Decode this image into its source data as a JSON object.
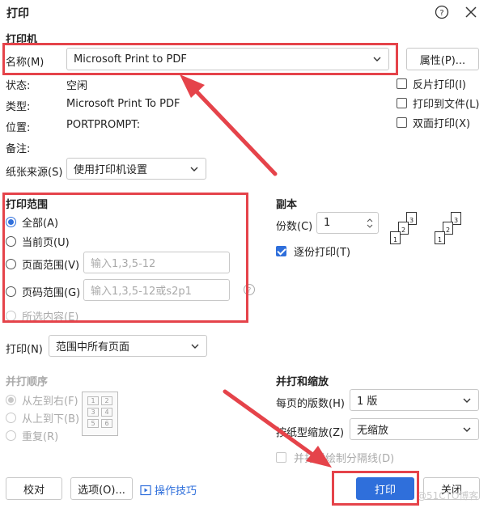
{
  "window": {
    "title": "打印"
  },
  "printer": {
    "section": "打印机",
    "name_label": "名称(M)",
    "name_value": "Microsoft Print to PDF",
    "properties_btn": "属性(P)...",
    "status_label": "状态:",
    "status_value": "空闲",
    "type_label": "类型:",
    "type_value": "Microsoft Print To PDF",
    "location_label": "位置:",
    "location_value": "PORTPROMPT:",
    "comment_label": "备注:",
    "reverse_print": "反片打印(I)",
    "print_to_file": "打印到文件(L)",
    "duplex": "双面打印(X)",
    "paper_source_label": "纸张来源(S)",
    "paper_source_value": "使用打印机设置"
  },
  "range": {
    "section": "打印范围",
    "all": "全部(A)",
    "current": "当前页(U)",
    "pages": "页面范围(V)",
    "pages_placeholder": "输入1,3,5-12",
    "page_no": "页码范围(G)",
    "page_no_placeholder": "输入1,3,5-12或s2p1",
    "selection": "所选内容(E)"
  },
  "copies": {
    "section": "副本",
    "count_label": "份数(C)",
    "count_value": "1",
    "collate": "逐份打印(T)",
    "stack_a": [
      "3",
      "2",
      "1"
    ],
    "stack_b": [
      "3",
      "2",
      "1"
    ]
  },
  "print_what": {
    "label": "打印(N)",
    "value": "范围中所有页面"
  },
  "order": {
    "section": "并打顺序",
    "left_to_right": "从左到右(F)",
    "top_to_bottom": "从上到下(B)",
    "repeat": "重复(R)",
    "grid": [
      "1",
      "2",
      "3",
      "4",
      "5",
      "6"
    ]
  },
  "zoom": {
    "section": "并打和缩放",
    "per_page_label": "每页的版数(H)",
    "per_page_value": "1 版",
    "scale_label": "按纸型缩放(Z)",
    "scale_value": "无缩放",
    "draw_lines": "并打时绘制分隔线(D)"
  },
  "footer": {
    "proof": "校对",
    "options": "选项(O)...",
    "tips": "操作技巧",
    "print": "打印",
    "close": "关闭",
    "watermark": "@51CTO博客"
  },
  "colors": {
    "accent": "#2f6fdb",
    "annotation": "#e5434a"
  }
}
